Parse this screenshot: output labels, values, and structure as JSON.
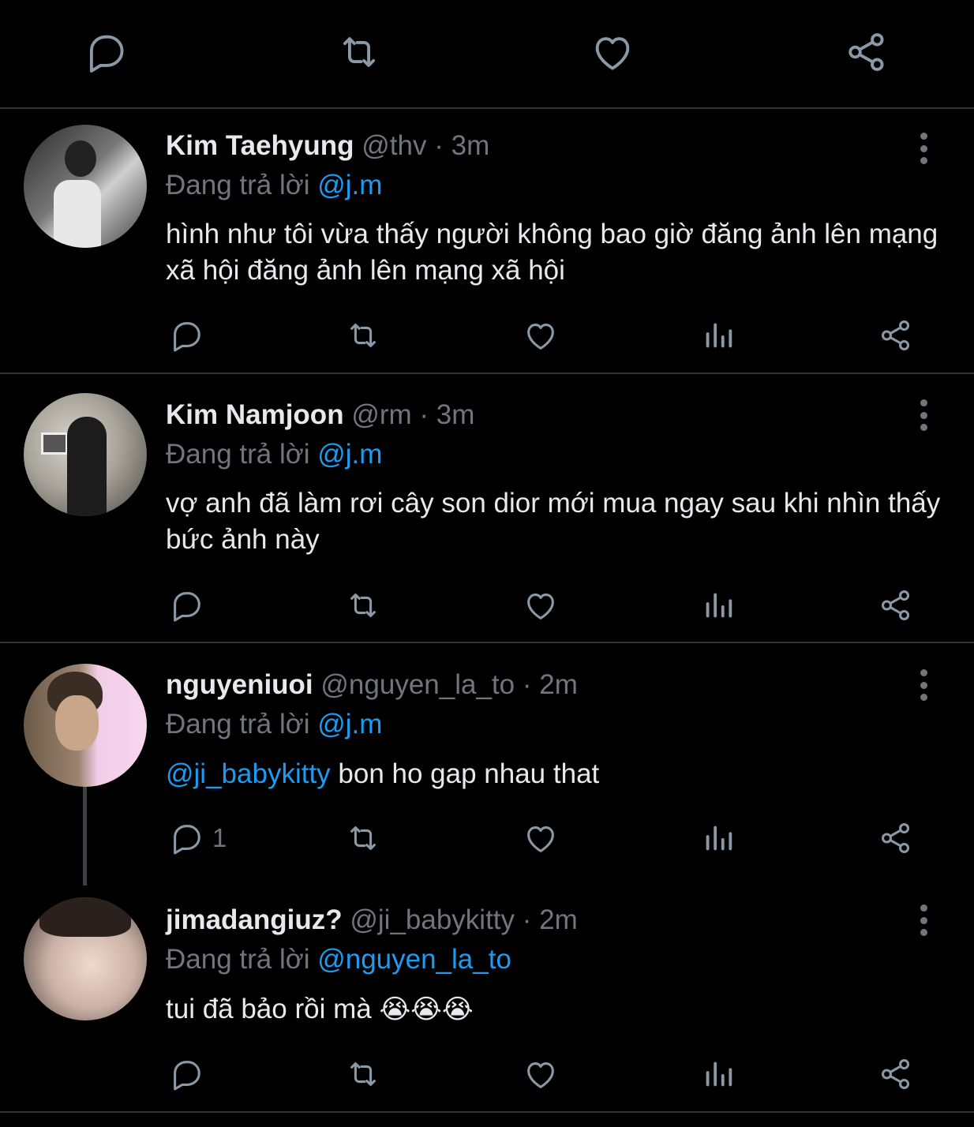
{
  "colors": {
    "background": "#000000",
    "text": "#e7e9ea",
    "muted": "#71767b",
    "accent": "#1d9bf0",
    "divider": "#2f3336"
  },
  "top_actions": {
    "icons": [
      "reply-icon",
      "retweet-icon",
      "like-icon",
      "share-icon"
    ]
  },
  "tweets": [
    {
      "name": "Kim Taehyung",
      "handle": "@thv",
      "separator": "·",
      "time": "3m",
      "reply_prefix": "Đang trả lời",
      "reply_to": "@j.m",
      "body": "hình như tôi vừa thấy người không bao giờ đăng ảnh lên mạng xã hội đăng ảnh lên mạng xã hội",
      "reply_count": ""
    },
    {
      "name": "Kim Namjoon",
      "handle": "@rm",
      "separator": "·",
      "time": "3m",
      "reply_prefix": "Đang trả lời",
      "reply_to": "@j.m",
      "body": "vợ anh đã làm rơi cây son dior mới mua ngay sau khi nhìn thấy bức ảnh này",
      "reply_count": ""
    },
    {
      "name": "nguyeniuoi",
      "handle": "@nguyen_la_to",
      "separator": "·",
      "time": "2m",
      "reply_prefix": "Đang trả lời",
      "reply_to": "@j.m",
      "body_mention": "@ji_babykitty",
      "body": " bon ho gap nhau that",
      "reply_count": "1"
    },
    {
      "name": "jimadangiuz?",
      "handle": "@ji_babykitty",
      "separator": "·",
      "time": "2m",
      "reply_prefix": "Đang trả lời",
      "reply_to": "@nguyen_la_to",
      "body": "tui đã bảo rồi mà ",
      "body_emoji": "😭😭😭",
      "reply_count": ""
    }
  ]
}
